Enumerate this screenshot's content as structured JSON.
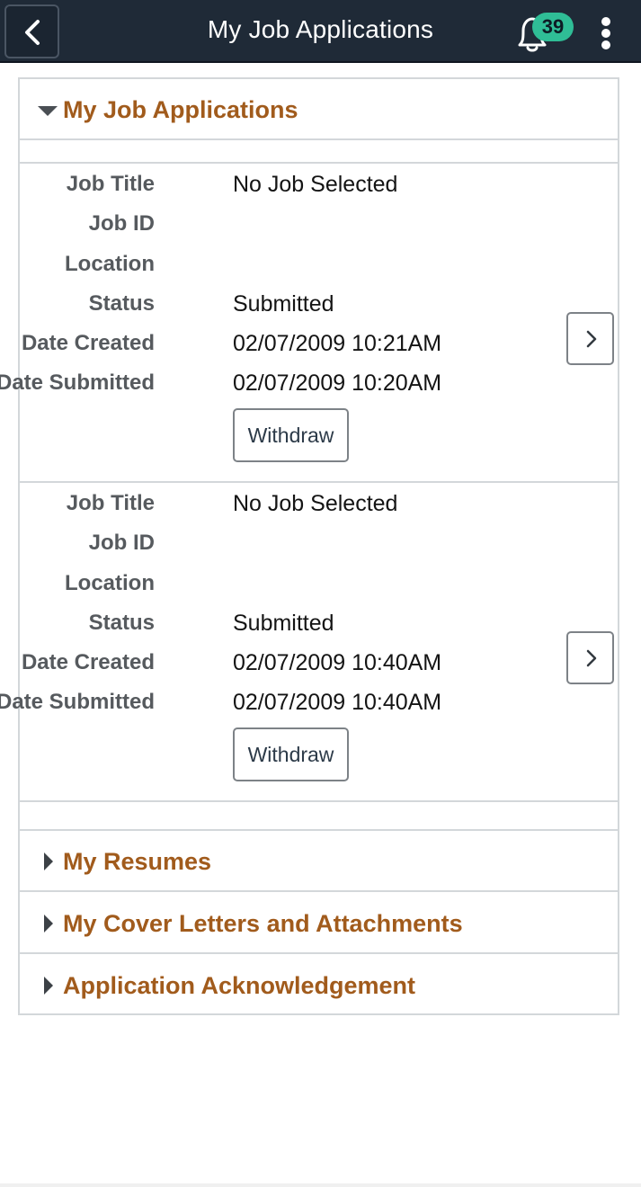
{
  "header": {
    "title": "My Job Applications",
    "back_icon": "chevron-left-icon",
    "notifications_icon": "bell-icon",
    "notification_count": "39",
    "menu_icon": "more-vertical-icon"
  },
  "sections": {
    "job_applications": {
      "title": "My Job Applications",
      "expanded": true
    },
    "resumes": {
      "title": "My Resumes",
      "expanded": false
    },
    "cover_letters": {
      "title": "My Cover Letters and Attachments",
      "expanded": false
    },
    "acknowledgement": {
      "title": "Application Acknowledgement",
      "expanded": false
    }
  },
  "labels": {
    "job_title": "Job Title",
    "job_id": "Job ID",
    "location": "Location",
    "status": "Status",
    "date_created": "Date Created",
    "date_submitted": "Date Submitted",
    "withdraw": "Withdraw"
  },
  "applications": [
    {
      "job_title": "No Job Selected",
      "job_id": "",
      "location": "",
      "status": "Submitted",
      "date_created": "02/07/2009 10:21AM",
      "date_submitted": "02/07/2009 10:20AM"
    },
    {
      "job_title": "No Job Selected",
      "job_id": "",
      "location": "",
      "status": "Submitted",
      "date_created": "02/07/2009 10:40AM",
      "date_submitted": "02/07/2009 10:40AM"
    }
  ],
  "colors": {
    "header_bg": "#1f2a37",
    "section_title": "#a15b1c",
    "badge": "#2fbd96",
    "border": "#d3d7da"
  }
}
